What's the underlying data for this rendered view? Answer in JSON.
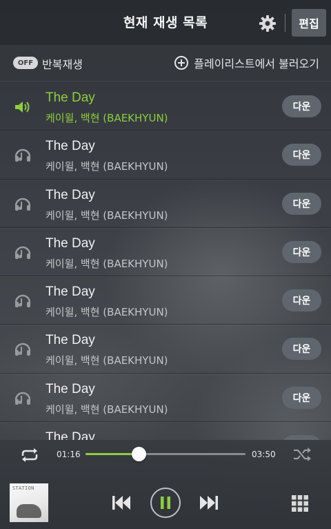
{
  "header": {
    "title": "현재 재생 목록",
    "edit_label": "편집",
    "settings_icon": "gear-icon"
  },
  "subbar": {
    "repeat_toggle_state": "OFF",
    "repeat_label": "반복재생",
    "load_playlist_label": "플레이리스트에서 불러오기"
  },
  "colors": {
    "accent": "#8dcf3a",
    "button_bg": "#5f666d",
    "header_bg": "#282b30"
  },
  "tracks": [
    {
      "title": "The Day",
      "artist": "케이윌, 백현 (BAEKHYUN)",
      "button": "다운",
      "active": true,
      "icon": "speaker-icon"
    },
    {
      "title": "The Day",
      "artist": "케이윌, 백현 (BAEKHYUN)",
      "button": "다운",
      "active": false,
      "icon": "music-note-icon"
    },
    {
      "title": "The Day",
      "artist": "케이윌, 백현 (BAEKHYUN)",
      "button": "다운",
      "active": false,
      "icon": "music-note-icon"
    },
    {
      "title": "The Day",
      "artist": "케이윌, 백현 (BAEKHYUN)",
      "button": "다운",
      "active": false,
      "icon": "music-note-icon"
    },
    {
      "title": "The Day",
      "artist": "케이윌, 백현 (BAEKHYUN)",
      "button": "다운",
      "active": false,
      "icon": "music-note-icon"
    },
    {
      "title": "The Day",
      "artist": "케이윌, 백현 (BAEKHYUN)",
      "button": "다운",
      "active": false,
      "icon": "music-note-icon"
    },
    {
      "title": "The Day",
      "artist": "케이윌, 백현 (BAEKHYUN)",
      "button": "다운",
      "active": false,
      "icon": "music-note-icon"
    },
    {
      "title": "The Day",
      "artist": "",
      "button": "",
      "active": false,
      "icon": "music-note-icon"
    }
  ],
  "player": {
    "elapsed": "01:16",
    "total": "03:50",
    "progress_fraction": 0.33,
    "album_text": "STATION",
    "state": "playing"
  }
}
